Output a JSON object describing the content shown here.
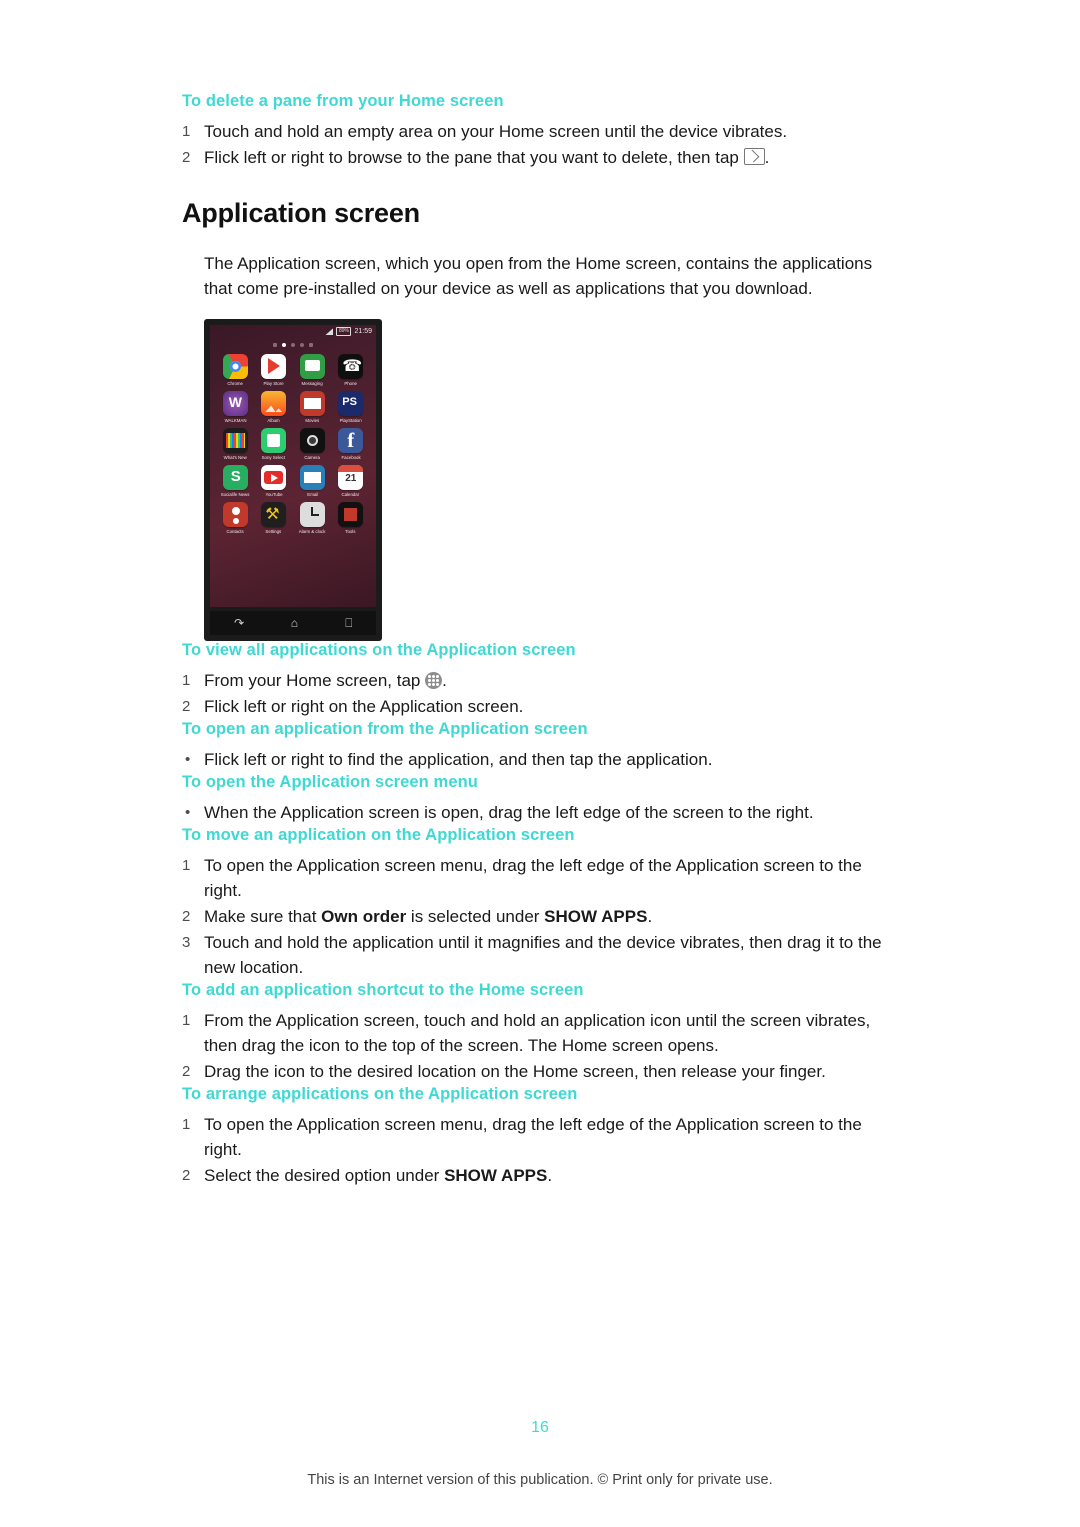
{
  "document": {
    "page_number": "16",
    "footer": "This is an Internet version of this publication. © Print only for private use."
  },
  "sections": [
    {
      "heading": "To delete a pane from your Home screen",
      "steps": [
        "Touch and hold an empty area on your Home screen until the device vibrates.",
        "Flick left or right to browse to the pane that you want to delete, then tap "
      ],
      "step_numbers": [
        "1",
        "2"
      ],
      "trailing": "."
    }
  ],
  "title": "Application screen",
  "intro": "The Application screen, which you open from the Home screen, contains the applications that come pre-installed on your device as well as applications that you download.",
  "phone": {
    "status_time": "21:59",
    "status_battery": "89%",
    "apps": [
      {
        "label": "Chrome",
        "icon": "chrome-icon"
      },
      {
        "label": "Play Store",
        "icon": "play-store-icon"
      },
      {
        "label": "Messaging",
        "icon": "messaging-icon"
      },
      {
        "label": "Phone",
        "icon": "phone-icon"
      },
      {
        "label": "WALKMAN",
        "icon": "walkman-icon"
      },
      {
        "label": "Album",
        "icon": "album-icon"
      },
      {
        "label": "Movies",
        "icon": "movies-icon"
      },
      {
        "label": "PlayStation",
        "icon": "playstation-icon"
      },
      {
        "label": "What's New",
        "icon": "whats-new-icon"
      },
      {
        "label": "Sony Select",
        "icon": "sony-select-icon"
      },
      {
        "label": "Camera",
        "icon": "camera-icon"
      },
      {
        "label": "Facebook",
        "icon": "facebook-icon"
      },
      {
        "label": "Socialife News",
        "icon": "socialife-icon"
      },
      {
        "label": "YouTube",
        "icon": "youtube-icon"
      },
      {
        "label": "Email",
        "icon": "email-icon"
      },
      {
        "label": "Calendar",
        "icon": "calendar-icon"
      },
      {
        "label": "Contacts",
        "icon": "contacts-icon"
      },
      {
        "label": "Settings",
        "icon": "settings-icon"
      },
      {
        "label": "Alarm & clock",
        "icon": "alarm-clock-icon"
      },
      {
        "label": "Tools",
        "icon": "tools-icon"
      }
    ],
    "nav": {
      "back": "back-icon",
      "home": "home-icon",
      "recents": "recent-apps-icon"
    }
  },
  "s2": {
    "heading": "To view all applications on the Application screen",
    "n1": "1",
    "t1a": "From your Home screen, tap ",
    "t1b": ".",
    "n2": "2",
    "t2": "Flick left or right on the Application screen."
  },
  "s3": {
    "heading": "To open an application from the Application screen",
    "b1": "Flick left or right to find the application, and then tap the application."
  },
  "s4": {
    "heading": "To open the Application screen menu",
    "b1": "When the Application screen is open, drag the left edge of the screen to the right."
  },
  "s5": {
    "heading": "To move an application on the Application screen",
    "n1": "1",
    "t1": "To open the Application screen menu, drag the left edge of the Application screen to the right.",
    "n2": "2",
    "t2a": "Make sure that ",
    "t2b": "Own order",
    "t2c": " is selected under ",
    "t2d": "SHOW APPS",
    "t2e": ".",
    "n3": "3",
    "t3": "Touch and hold the application until it magnifies and the device vibrates, then drag it to the new location."
  },
  "s6": {
    "heading": "To add an application shortcut to the Home screen",
    "n1": "1",
    "t1": "From the Application screen, touch and hold an application icon until the screen vibrates, then drag the icon to the top of the screen. The Home screen opens.",
    "n2": "2",
    "t2": "Drag the icon to the desired location on the Home screen, then release your finger."
  },
  "s7": {
    "heading": "To arrange applications on the Application screen",
    "n1": "1",
    "t1": "To open the Application screen menu, drag the left edge of the Application screen to the right.",
    "n2": "2",
    "t2a": "Select the desired option under ",
    "t2b": "SHOW APPS",
    "t2c": "."
  },
  "colors": {
    "heading_accent": "#3fd9d4",
    "body_text": "#1a1a1a"
  }
}
